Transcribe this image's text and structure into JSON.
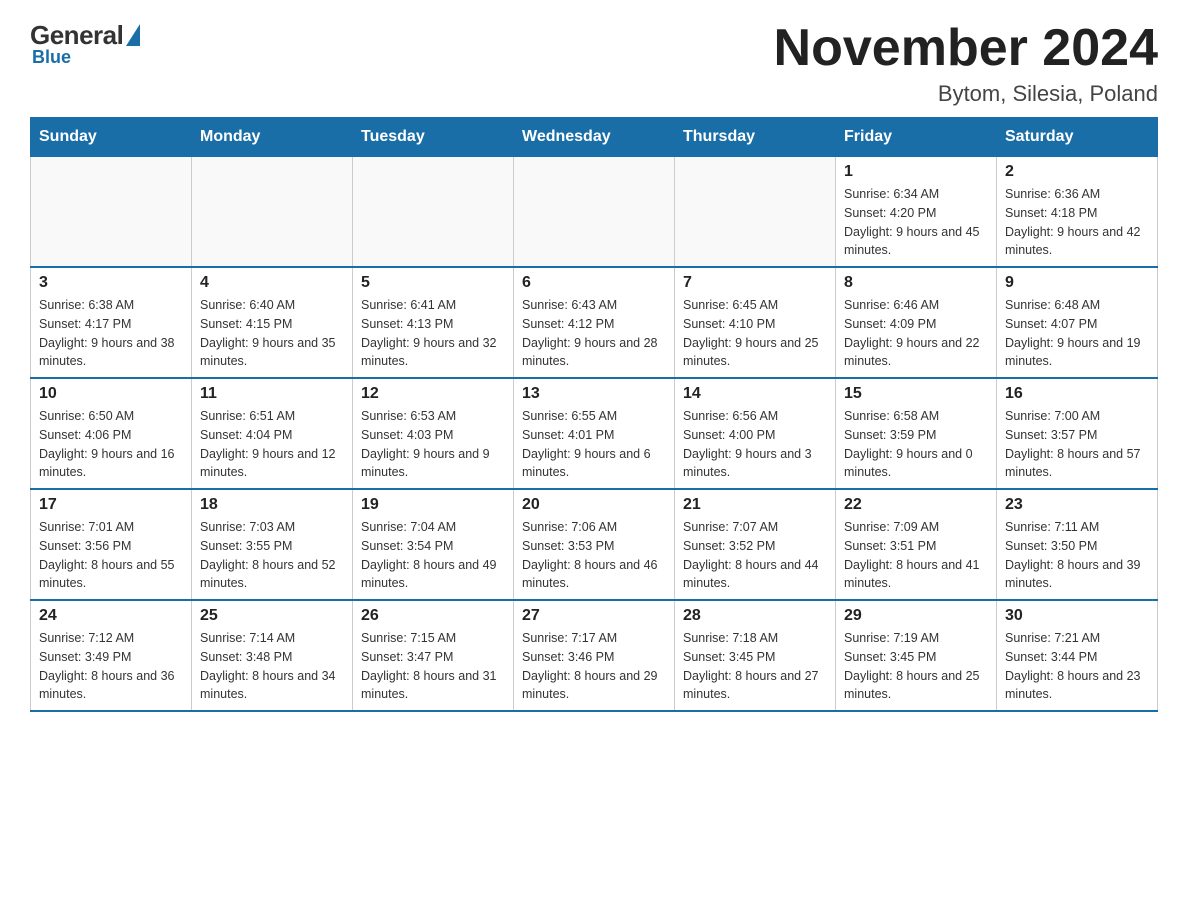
{
  "logo": {
    "general": "General",
    "blue": "Blue"
  },
  "title": "November 2024",
  "subtitle": "Bytom, Silesia, Poland",
  "weekdays": [
    "Sunday",
    "Monday",
    "Tuesday",
    "Wednesday",
    "Thursday",
    "Friday",
    "Saturday"
  ],
  "weeks": [
    [
      {
        "day": "",
        "info": ""
      },
      {
        "day": "",
        "info": ""
      },
      {
        "day": "",
        "info": ""
      },
      {
        "day": "",
        "info": ""
      },
      {
        "day": "",
        "info": ""
      },
      {
        "day": "1",
        "info": "Sunrise: 6:34 AM\nSunset: 4:20 PM\nDaylight: 9 hours and 45 minutes."
      },
      {
        "day": "2",
        "info": "Sunrise: 6:36 AM\nSunset: 4:18 PM\nDaylight: 9 hours and 42 minutes."
      }
    ],
    [
      {
        "day": "3",
        "info": "Sunrise: 6:38 AM\nSunset: 4:17 PM\nDaylight: 9 hours and 38 minutes."
      },
      {
        "day": "4",
        "info": "Sunrise: 6:40 AM\nSunset: 4:15 PM\nDaylight: 9 hours and 35 minutes."
      },
      {
        "day": "5",
        "info": "Sunrise: 6:41 AM\nSunset: 4:13 PM\nDaylight: 9 hours and 32 minutes."
      },
      {
        "day": "6",
        "info": "Sunrise: 6:43 AM\nSunset: 4:12 PM\nDaylight: 9 hours and 28 minutes."
      },
      {
        "day": "7",
        "info": "Sunrise: 6:45 AM\nSunset: 4:10 PM\nDaylight: 9 hours and 25 minutes."
      },
      {
        "day": "8",
        "info": "Sunrise: 6:46 AM\nSunset: 4:09 PM\nDaylight: 9 hours and 22 minutes."
      },
      {
        "day": "9",
        "info": "Sunrise: 6:48 AM\nSunset: 4:07 PM\nDaylight: 9 hours and 19 minutes."
      }
    ],
    [
      {
        "day": "10",
        "info": "Sunrise: 6:50 AM\nSunset: 4:06 PM\nDaylight: 9 hours and 16 minutes."
      },
      {
        "day": "11",
        "info": "Sunrise: 6:51 AM\nSunset: 4:04 PM\nDaylight: 9 hours and 12 minutes."
      },
      {
        "day": "12",
        "info": "Sunrise: 6:53 AM\nSunset: 4:03 PM\nDaylight: 9 hours and 9 minutes."
      },
      {
        "day": "13",
        "info": "Sunrise: 6:55 AM\nSunset: 4:01 PM\nDaylight: 9 hours and 6 minutes."
      },
      {
        "day": "14",
        "info": "Sunrise: 6:56 AM\nSunset: 4:00 PM\nDaylight: 9 hours and 3 minutes."
      },
      {
        "day": "15",
        "info": "Sunrise: 6:58 AM\nSunset: 3:59 PM\nDaylight: 9 hours and 0 minutes."
      },
      {
        "day": "16",
        "info": "Sunrise: 7:00 AM\nSunset: 3:57 PM\nDaylight: 8 hours and 57 minutes."
      }
    ],
    [
      {
        "day": "17",
        "info": "Sunrise: 7:01 AM\nSunset: 3:56 PM\nDaylight: 8 hours and 55 minutes."
      },
      {
        "day": "18",
        "info": "Sunrise: 7:03 AM\nSunset: 3:55 PM\nDaylight: 8 hours and 52 minutes."
      },
      {
        "day": "19",
        "info": "Sunrise: 7:04 AM\nSunset: 3:54 PM\nDaylight: 8 hours and 49 minutes."
      },
      {
        "day": "20",
        "info": "Sunrise: 7:06 AM\nSunset: 3:53 PM\nDaylight: 8 hours and 46 minutes."
      },
      {
        "day": "21",
        "info": "Sunrise: 7:07 AM\nSunset: 3:52 PM\nDaylight: 8 hours and 44 minutes."
      },
      {
        "day": "22",
        "info": "Sunrise: 7:09 AM\nSunset: 3:51 PM\nDaylight: 8 hours and 41 minutes."
      },
      {
        "day": "23",
        "info": "Sunrise: 7:11 AM\nSunset: 3:50 PM\nDaylight: 8 hours and 39 minutes."
      }
    ],
    [
      {
        "day": "24",
        "info": "Sunrise: 7:12 AM\nSunset: 3:49 PM\nDaylight: 8 hours and 36 minutes."
      },
      {
        "day": "25",
        "info": "Sunrise: 7:14 AM\nSunset: 3:48 PM\nDaylight: 8 hours and 34 minutes."
      },
      {
        "day": "26",
        "info": "Sunrise: 7:15 AM\nSunset: 3:47 PM\nDaylight: 8 hours and 31 minutes."
      },
      {
        "day": "27",
        "info": "Sunrise: 7:17 AM\nSunset: 3:46 PM\nDaylight: 8 hours and 29 minutes."
      },
      {
        "day": "28",
        "info": "Sunrise: 7:18 AM\nSunset: 3:45 PM\nDaylight: 8 hours and 27 minutes."
      },
      {
        "day": "29",
        "info": "Sunrise: 7:19 AM\nSunset: 3:45 PM\nDaylight: 8 hours and 25 minutes."
      },
      {
        "day": "30",
        "info": "Sunrise: 7:21 AM\nSunset: 3:44 PM\nDaylight: 8 hours and 23 minutes."
      }
    ]
  ]
}
